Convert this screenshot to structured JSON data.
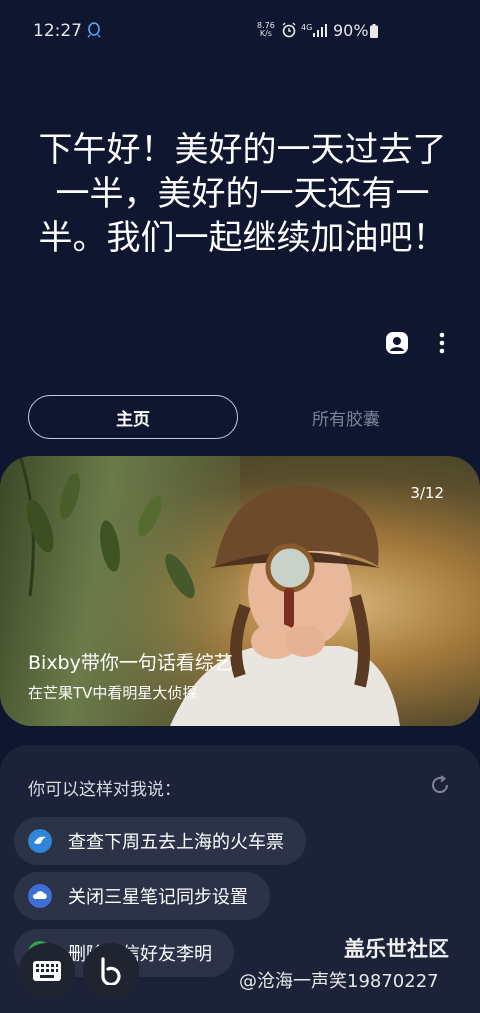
{
  "status_bar": {
    "time": "12:27",
    "net_speed_value": "8.76",
    "net_speed_unit": "K/s",
    "signal": "4G",
    "battery": "90%"
  },
  "greeting": "下午好！美好的一天过去了一半，美好的一天还有一半。我们一起继续加油吧！",
  "tabs": [
    {
      "label": "主页",
      "active": true
    },
    {
      "label": "所有胶囊",
      "active": false
    }
  ],
  "banner": {
    "counter": "3/12",
    "title": "Bixby带你一句话看综艺",
    "subtitle": "在芒果TV中看明星大侦探"
  },
  "suggestions_panel": {
    "title": "你可以这样对我说：",
    "items": [
      {
        "label": "查查下周五去上海的火车票",
        "icon": "ctrip-dolphin-icon",
        "icon_color": "#2f86d8"
      },
      {
        "label": "关闭三星笔记同步设置",
        "icon": "samsung-cloud-icon",
        "icon_color": "#3f6ed8"
      },
      {
        "label": "删除短信好友李明",
        "icon": "message-icon",
        "icon_color": "#2ea44f"
      }
    ]
  },
  "bottom_buttons": {
    "keyboard": "keyboard-icon",
    "bixby": "bixby-icon"
  },
  "watermark": {
    "line1": "盖乐世社区",
    "line2": "@沧海一声笑19870227"
  },
  "colors": {
    "background": "#0e1630",
    "panel": "#1c2238",
    "chip": "#2c3349",
    "inactive_tab": "#7d8294"
  }
}
